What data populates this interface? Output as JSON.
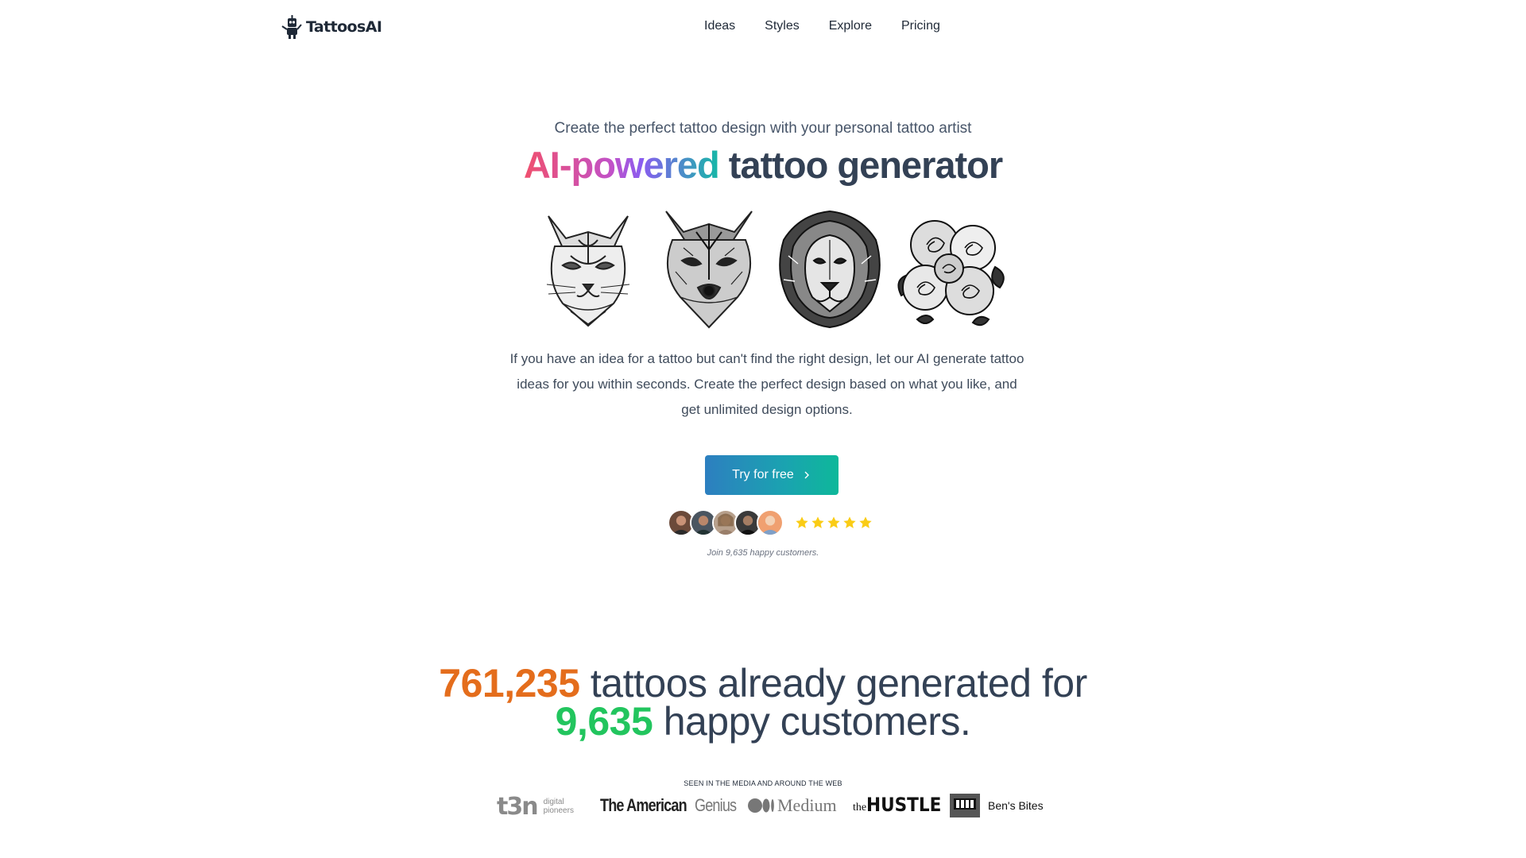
{
  "brand": {
    "name": "TattoosAI"
  },
  "nav": {
    "ideas": "Ideas",
    "styles": "Styles",
    "explore": "Explore",
    "pricing": "Pricing"
  },
  "hero": {
    "subtitle": "Create the perfect tattoo design with your personal tattoo artist",
    "title_highlight": "AI-powered",
    "title_rest": " tattoo generator",
    "tattoos": [
      "cat",
      "wolf",
      "lion",
      "roses"
    ],
    "description": "If you have an idea for a tattoo but can't find the right design, let our AI generate tattoo ideas for you within seconds. Create the perfect design based on what you like, and get unlimited design options.",
    "cta_label": "Try for free",
    "rating_stars": 5,
    "join_text": "Join 9,635 happy customers."
  },
  "stats": {
    "tattoos_count": "761,235",
    "tattoos_text": " tattoos already generated for",
    "customers_count": "9,635",
    "customers_text": " happy customers."
  },
  "media": {
    "label": "SEEN IN THE MEDIA AND AROUND THE WEB",
    "logos": {
      "t3n_word": "t3n",
      "t3n_line1": "digital",
      "t3n_line2": "pioneers",
      "american_genius_a": "The American",
      "american_genius_b": "Genius",
      "medium": "Medium",
      "hustle_pre": "the",
      "hustle_main": "HUSTLE",
      "bens_bites": "Ben's Bites"
    }
  },
  "colors": {
    "orange": "#e46d1c",
    "green": "#22c55e",
    "star": "#facc15",
    "cta_start": "#2d7fc0",
    "cta_end": "#0eb89a"
  }
}
